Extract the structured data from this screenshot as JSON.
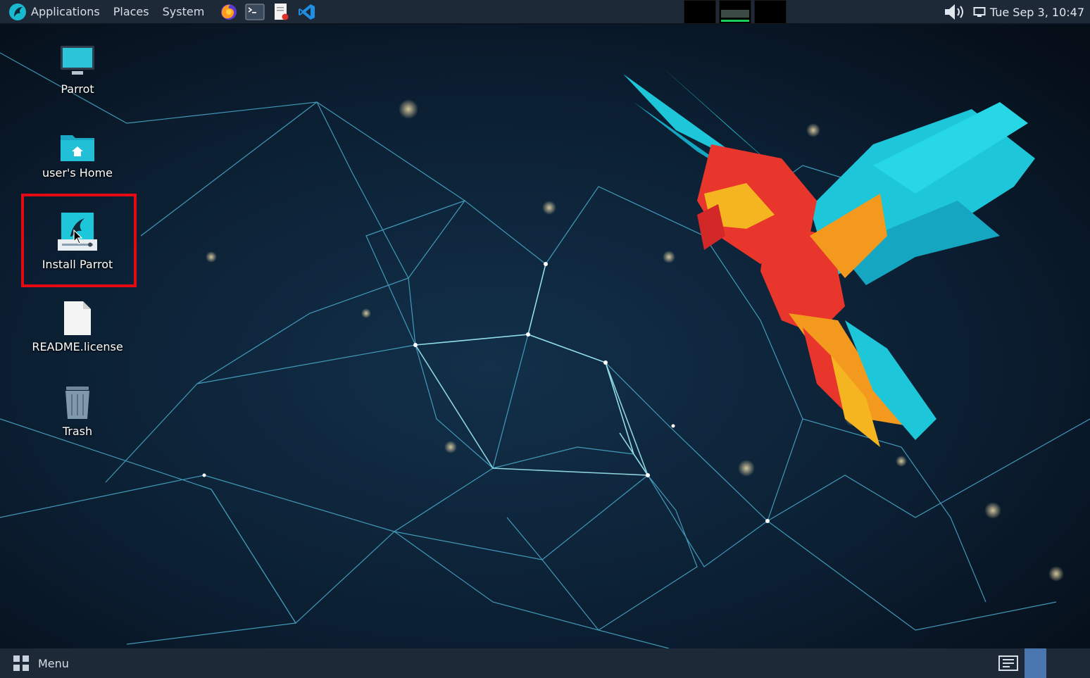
{
  "top_panel": {
    "menu": [
      "Applications",
      "Places",
      "System"
    ],
    "launchers": [
      "firefox-icon",
      "terminal-icon",
      "text-editor-icon",
      "vscode-icon"
    ],
    "clock": "Tue Sep 3, 10:47"
  },
  "desktop": {
    "icons": [
      {
        "label": "Parrot",
        "icon": "computer-icon"
      },
      {
        "label": "user's Home",
        "icon": "home-folder-icon"
      },
      {
        "label": "Install Parrot",
        "icon": "installer-icon"
      },
      {
        "label": "README.license",
        "icon": "file-icon"
      },
      {
        "label": "Trash",
        "icon": "trash-icon"
      }
    ],
    "highlight_color": "#e50914"
  },
  "bottom_panel": {
    "menu_label": "Menu"
  },
  "colors": {
    "panel": "#1d2937",
    "accent": "#19c8d8"
  }
}
